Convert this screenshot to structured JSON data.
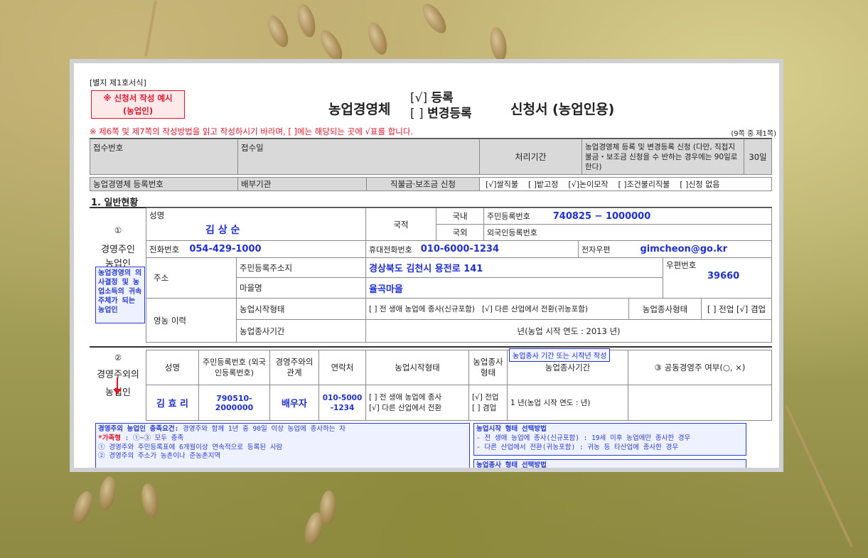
{
  "header": {
    "form_no": "[별지 제1호서식]",
    "example_line1": "※ 신청서 작성 예시",
    "example_line2": "(농업인)",
    "title_left": "농업경영체",
    "bracket1": "[√]",
    "bracket2": "[  ]",
    "opt_register": "등록",
    "opt_change": "변경등록",
    "title_right": "신청서 (농업인용)",
    "instruction": "※ 제6쪽 및 제7쪽의 작성방법을 읽고 작성하시기 바라며, [   ]에는 해당되는 곳에 √표를 합니다.",
    "page_info": "(9쪽 중 제1쪽)"
  },
  "receipt": {
    "receipt_no": "접수번호",
    "receipt_date": "접수일",
    "processing_period": "처리기간",
    "period_desc": "농업경영체 등록 및 변경등록 신청 (다만, 직접지불금・보조금 신청을 수 반하는 경우에는 90일로 한다)",
    "period_days": "30일"
  },
  "reg_row": {
    "reg_no": "농업경영체 등록번호",
    "dist_org": "배부기관",
    "subsidy": "직불금·보조금 신청",
    "opt1": "[√]쌀직불",
    "opt2": "[ ]밭고정",
    "opt3": "[√]논이모작",
    "opt4": "[ ]조건불리직불",
    "opt5": "[ ]신청 없음"
  },
  "section1": {
    "title": "1. 일반현황",
    "num1": "①",
    "owner": "경영주인",
    "owner2": "농업인",
    "name_label": "성명",
    "name_value": "김 상 순",
    "nationality": "국적",
    "domestic": "국내",
    "foreign": "국외",
    "rrn_label": "주민등록번호",
    "rrn_value": "740825 − 1000000",
    "foreign_reg": "외국인등록번호",
    "phone_label": "전화번호",
    "phone_value": "054-429-1000",
    "mobile_label": "휴대전화번호",
    "mobile_value": "010-6000-1234",
    "email_label": "전자우편",
    "email_value": "gimcheon@go.kr",
    "address": "주소",
    "reg_address": "주민등록주소지",
    "reg_address_value": "경상북도 김천시 용전로 141",
    "postal_label": "우편번호",
    "postal_value": "39660",
    "village": "마을명",
    "village_value": "율곡마을",
    "history": "영농 이력",
    "start_type": "농업시작형태",
    "start_type_value_a": "[ ] 전 생애 농업에 종사(신규포함)",
    "start_type_value_b": "[√] 다른 산업에서 전환(귀농포함)",
    "engage_type": "농업종사형태",
    "engage_opt": "[ ] 전업 [√] 겸업",
    "engage_period": "농업종사기간",
    "engage_period_value": "년(농업 시작 연도 : 2013 년)",
    "side_note": "농업경영의 의사결정 및 농업소득의 귀속 주체가 되는 농업인"
  },
  "section2": {
    "num2": "②",
    "label1": "경영주외의",
    "label2": "농업인",
    "h_name": "성명",
    "h_rrn": "주민등록번호 (외국인등록번호)",
    "h_rel": "경영주와의 관계",
    "h_contact": "연락처",
    "h_start": "농업시작형태",
    "h_engage": "농업종사 형태",
    "h_period": "농업종사기간",
    "h_joint": "③ 공동경영주 여부(○, ×)",
    "tag": "농업종사 기간 또는 시작년 작성",
    "row_name": "김 효 리",
    "row_rrn": "790510-2000000",
    "row_rel": "배우자",
    "row_contact": "010-5000 -1234",
    "row_start_a": "[ ] 전 생애 농업에 종사",
    "row_start_b": "[√] 다른 산업에서 전환",
    "row_engage_a": "[√] 전업",
    "row_engage_b": "[ ] 겸업",
    "row_period": "1  년(농업 시작 연도 :      년)"
  },
  "notes": {
    "left_title": "경영주외 농업인 충족요건:",
    "left_title_rest": " 경영주와 함께 1년 중 90일 이상 농업에 종사하는 자",
    "left_line1_bold": "*가족형",
    "left_line1": " : ①~③ 모두 충족",
    "left_line2": "① 경영주와 주민등록표에 6개월이상 연속적으로 등록된 사람",
    "left_line3": "② 경영주의 주소가 농촌이나 준농촌지역",
    "right_title": "농업시작 형태 선택방법",
    "right_line1": "- 전 생애 농업에 종사(신규포함) : 19세 이후 농업에만 종사한 경우",
    "right_line2": "- 다른 산업에서 전환(귀농포함) : 귀농 등 타산업에 종사한 경우",
    "right_title2": "농업종사 형태 선택방법"
  }
}
